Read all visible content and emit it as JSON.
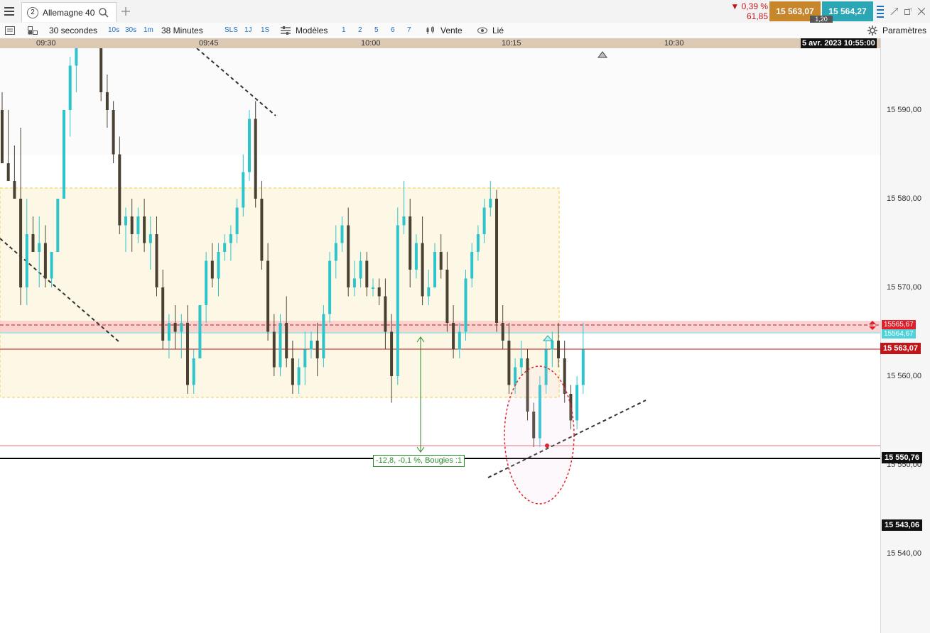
{
  "tab": {
    "number": "2",
    "name": "Allemagne 40"
  },
  "quote": {
    "change_pct": "▼ 0,39 %",
    "change_abs": "61,85",
    "bid": "15 563,07",
    "ask": "15 564,27",
    "spread": "1,20"
  },
  "toolbar": {
    "interval": "30 secondes",
    "quick_intervals": [
      "10s",
      "30s",
      "1m"
    ],
    "duration": "38 Minutes",
    "quick_ranges": [
      "SLS",
      "1J",
      "1S"
    ],
    "models": "Modèles",
    "counts": [
      "1",
      "2",
      "5",
      "6",
      "7"
    ],
    "sell": "Vente",
    "linked": "Lié",
    "settings": "Paramètres"
  },
  "time_axis": {
    "labels": [
      "09:30",
      "09:45",
      "10:00",
      "10:15",
      "10:30"
    ],
    "cursor": "5 avr. 2023 10:55:00"
  },
  "price_axis": {
    "ticks": [
      "15 590,00",
      "15 580,00",
      "15 570,00",
      "15 560,00",
      "15 550,00",
      "15 540,00"
    ],
    "flags": {
      "resistance": "15565,67",
      "ask": "15564,67",
      "last": "15 563,07",
      "support": "15 550,76",
      "cursor": "15 543,06"
    }
  },
  "annotation": {
    "measure": "-12,8, -0,1 %, Bougies :1"
  },
  "colors": {
    "up": "#2ec4cc",
    "down": "#4b4133",
    "last": "#c0161a",
    "accent": "#c8862a",
    "ask_bg": "#2aa6b5"
  },
  "chart_data": {
    "type": "candlestick",
    "ylim": [
      15533,
      15600
    ],
    "x_ticks": [
      "09:30",
      "09:45",
      "10:00",
      "10:15",
      "10:30"
    ],
    "candles": [
      {
        "o": 15590,
        "h": 15592,
        "l": 15584,
        "c": 15584
      },
      {
        "o": 15584,
        "h": 15590,
        "l": 15582,
        "c": 15582
      },
      {
        "o": 15582,
        "h": 15586,
        "l": 15580,
        "c": 15580
      },
      {
        "o": 15580,
        "h": 15588,
        "l": 15568,
        "c": 15570
      },
      {
        "o": 15570,
        "h": 15580,
        "l": 15568,
        "c": 15576
      },
      {
        "o": 15576,
        "h": 15578,
        "l": 15574,
        "c": 15574
      },
      {
        "o": 15574,
        "h": 15578,
        "l": 15570,
        "c": 15575
      },
      {
        "o": 15575,
        "h": 15577,
        "l": 15570,
        "c": 15571
      },
      {
        "o": 15571,
        "h": 15574,
        "l": 15570,
        "c": 15574
      },
      {
        "o": 15574,
        "h": 15580,
        "l": 15574,
        "c": 15580
      },
      {
        "o": 15580,
        "h": 15590,
        "l": 15580,
        "c": 15590
      },
      {
        "o": 15590,
        "h": 15596,
        "l": 15587,
        "c": 15595
      },
      {
        "o": 15595,
        "h": 15601,
        "l": 15592,
        "c": 15599
      },
      {
        "o": 15599,
        "h": 15602,
        "l": 15598,
        "c": 15600
      },
      {
        "o": 15600,
        "h": 15602,
        "l": 15598,
        "c": 15601
      },
      {
        "o": 15601,
        "h": 15603,
        "l": 15598,
        "c": 15602
      },
      {
        "o": 15602,
        "h": 15604,
        "l": 15591,
        "c": 15592
      },
      {
        "o": 15592,
        "h": 15594,
        "l": 15588,
        "c": 15590
      },
      {
        "o": 15590,
        "h": 15591,
        "l": 15584,
        "c": 15585
      },
      {
        "o": 15585,
        "h": 15587,
        "l": 15576,
        "c": 15577
      },
      {
        "o": 15577,
        "h": 15579,
        "l": 15574,
        "c": 15578
      },
      {
        "o": 15578,
        "h": 15580,
        "l": 15574,
        "c": 15576
      },
      {
        "o": 15576,
        "h": 15579,
        "l": 15575,
        "c": 15578
      },
      {
        "o": 15578,
        "h": 15580,
        "l": 15574,
        "c": 15575
      },
      {
        "o": 15575,
        "h": 15578,
        "l": 15572,
        "c": 15576
      },
      {
        "o": 15576,
        "h": 15578,
        "l": 15569,
        "c": 15570
      },
      {
        "o": 15570,
        "h": 15572,
        "l": 15563,
        "c": 15564
      },
      {
        "o": 15564,
        "h": 15567,
        "l": 15562,
        "c": 15566
      },
      {
        "o": 15566,
        "h": 15568,
        "l": 15563,
        "c": 15565
      },
      {
        "o": 15565,
        "h": 15567,
        "l": 15562,
        "c": 15566
      },
      {
        "o": 15566,
        "h": 15568,
        "l": 15558,
        "c": 15559
      },
      {
        "o": 15559,
        "h": 15563,
        "l": 15558,
        "c": 15562
      },
      {
        "o": 15562,
        "h": 15568,
        "l": 15562,
        "c": 15568
      },
      {
        "o": 15568,
        "h": 15574,
        "l": 15566,
        "c": 15573
      },
      {
        "o": 15573,
        "h": 15575,
        "l": 15570,
        "c": 15571
      },
      {
        "o": 15571,
        "h": 15575,
        "l": 15569,
        "c": 15574
      },
      {
        "o": 15574,
        "h": 15576,
        "l": 15573,
        "c": 15575
      },
      {
        "o": 15575,
        "h": 15577,
        "l": 15573,
        "c": 15576
      },
      {
        "o": 15576,
        "h": 15580,
        "l": 15575,
        "c": 15579
      },
      {
        "o": 15579,
        "h": 15585,
        "l": 15578,
        "c": 15583
      },
      {
        "o": 15583,
        "h": 15590,
        "l": 15582,
        "c": 15589
      },
      {
        "o": 15589,
        "h": 15591,
        "l": 15579,
        "c": 15580
      },
      {
        "o": 15580,
        "h": 15582,
        "l": 15572,
        "c": 15573
      },
      {
        "o": 15573,
        "h": 15575,
        "l": 15564,
        "c": 15565
      },
      {
        "o": 15565,
        "h": 15567,
        "l": 15560,
        "c": 15561
      },
      {
        "o": 15561,
        "h": 15567,
        "l": 15560,
        "c": 15566
      },
      {
        "o": 15566,
        "h": 15569,
        "l": 15561,
        "c": 15562
      },
      {
        "o": 15562,
        "h": 15564,
        "l": 15558,
        "c": 15559
      },
      {
        "o": 15559,
        "h": 15562,
        "l": 15558,
        "c": 15561
      },
      {
        "o": 15561,
        "h": 15565,
        "l": 15559,
        "c": 15563
      },
      {
        "o": 15563,
        "h": 15565,
        "l": 15562,
        "c": 15564
      },
      {
        "o": 15564,
        "h": 15566,
        "l": 15560,
        "c": 15562
      },
      {
        "o": 15562,
        "h": 15568,
        "l": 15561,
        "c": 15567
      },
      {
        "o": 15567,
        "h": 15574,
        "l": 15566,
        "c": 15573
      },
      {
        "o": 15573,
        "h": 15577,
        "l": 15571,
        "c": 15575
      },
      {
        "o": 15575,
        "h": 15578,
        "l": 15574,
        "c": 15577
      },
      {
        "o": 15577,
        "h": 15579,
        "l": 15569,
        "c": 15570
      },
      {
        "o": 15570,
        "h": 15573,
        "l": 15569,
        "c": 15571
      },
      {
        "o": 15571,
        "h": 15574,
        "l": 15570,
        "c": 15573
      },
      {
        "o": 15573,
        "h": 15574,
        "l": 15569,
        "c": 15570
      },
      {
        "o": 15570,
        "h": 15571,
        "l": 15569,
        "c": 15570
      },
      {
        "o": 15570,
        "h": 15571,
        "l": 15568,
        "c": 15569
      },
      {
        "o": 15569,
        "h": 15571,
        "l": 15563,
        "c": 15565
      },
      {
        "o": 15565,
        "h": 15567,
        "l": 15557,
        "c": 15560
      },
      {
        "o": 15560,
        "h": 15579,
        "l": 15559,
        "c": 15577
      },
      {
        "o": 15577,
        "h": 15582,
        "l": 15576,
        "c": 15578
      },
      {
        "o": 15578,
        "h": 15580,
        "l": 15570,
        "c": 15572
      },
      {
        "o": 15572,
        "h": 15576,
        "l": 15571,
        "c": 15575
      },
      {
        "o": 15575,
        "h": 15578,
        "l": 15568,
        "c": 15569
      },
      {
        "o": 15569,
        "h": 15572,
        "l": 15568,
        "c": 15570
      },
      {
        "o": 15570,
        "h": 15575,
        "l": 15570,
        "c": 15574
      },
      {
        "o": 15574,
        "h": 15576,
        "l": 15571,
        "c": 15572
      },
      {
        "o": 15572,
        "h": 15574,
        "l": 15565,
        "c": 15566
      },
      {
        "o": 15566,
        "h": 15568,
        "l": 15562,
        "c": 15563
      },
      {
        "o": 15563,
        "h": 15566,
        "l": 15562,
        "c": 15565
      },
      {
        "o": 15565,
        "h": 15572,
        "l": 15564,
        "c": 15571
      },
      {
        "o": 15571,
        "h": 15575,
        "l": 15570,
        "c": 15574
      },
      {
        "o": 15574,
        "h": 15577,
        "l": 15573,
        "c": 15576
      },
      {
        "o": 15576,
        "h": 15580,
        "l": 15575,
        "c": 15579
      },
      {
        "o": 15579,
        "h": 15582,
        "l": 15578,
        "c": 15580
      },
      {
        "o": 15580,
        "h": 15581,
        "l": 15565,
        "c": 15566
      },
      {
        "o": 15566,
        "h": 15568,
        "l": 15563,
        "c": 15564
      },
      {
        "o": 15564,
        "h": 15566,
        "l": 15558,
        "c": 15559
      },
      {
        "o": 15559,
        "h": 15562,
        "l": 15558,
        "c": 15561
      },
      {
        "o": 15561,
        "h": 15564,
        "l": 15560,
        "c": 15562
      },
      {
        "o": 15562,
        "h": 15563,
        "l": 15555,
        "c": 15556
      },
      {
        "o": 15556,
        "h": 15557,
        "l": 15552,
        "c": 15553
      },
      {
        "o": 15553,
        "h": 15560,
        "l": 15552,
        "c": 15559
      },
      {
        "o": 15559,
        "h": 15564,
        "l": 15558,
        "c": 15563
      },
      {
        "o": 15563,
        "h": 15565,
        "l": 15561,
        "c": 15564
      },
      {
        "o": 15564,
        "h": 15566,
        "l": 15561,
        "c": 15562
      },
      {
        "o": 15562,
        "h": 15564,
        "l": 15557,
        "c": 15558
      },
      {
        "o": 15558,
        "h": 15559,
        "l": 15554,
        "c": 15555
      },
      {
        "o": 15555,
        "h": 15560,
        "l": 15554,
        "c": 15559
      },
      {
        "o": 15559,
        "h": 15566,
        "l": 15558,
        "c": 15563
      }
    ]
  }
}
